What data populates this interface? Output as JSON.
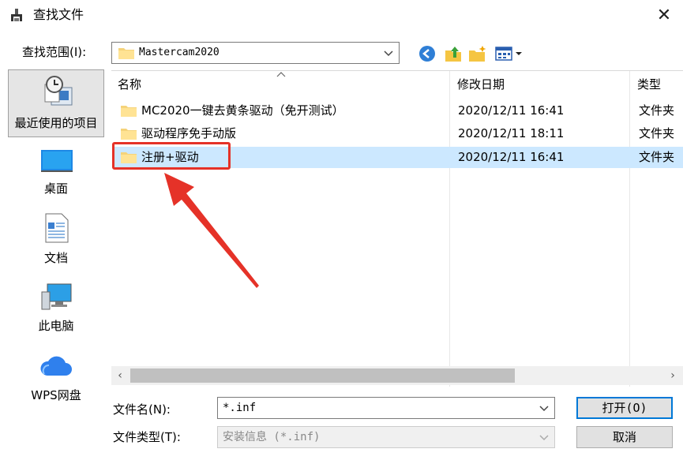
{
  "window": {
    "title": "查找文件",
    "close_glyph": "✕"
  },
  "look_in": {
    "label": "查找范围(I):",
    "value": "Mastercam2020"
  },
  "toolbar": {
    "icons": [
      "back-icon",
      "up-folder-icon",
      "new-folder-icon",
      "view-menu-icon"
    ]
  },
  "places": [
    {
      "label": "最近使用的项目",
      "icon": "recent-items-icon",
      "selected": true
    },
    {
      "label": "桌面",
      "icon": "desktop-icon",
      "selected": false
    },
    {
      "label": "文档",
      "icon": "documents-icon",
      "selected": false
    },
    {
      "label": "此电脑",
      "icon": "this-pc-icon",
      "selected": false
    },
    {
      "label": "WPS网盘",
      "icon": "wps-cloud-icon",
      "selected": false
    }
  ],
  "columns": {
    "name": "名称",
    "date": "修改日期",
    "type": "类型"
  },
  "files": [
    {
      "name": "MC2020一键去黄条驱动（免开测试）",
      "date": "2020/12/11 16:41",
      "type": "文件夹",
      "selected": false
    },
    {
      "name": "驱动程序免手动版",
      "date": "2020/12/11 18:11",
      "type": "文件夹",
      "selected": false
    },
    {
      "name": "注册+驱动",
      "date": "2020/12/11 16:41",
      "type": "文件夹",
      "selected": true
    }
  ],
  "file_name": {
    "label": "文件名(N):",
    "value": "*.inf"
  },
  "file_type": {
    "label": "文件类型(T):",
    "value": "安装信息 (*.inf)"
  },
  "buttons": {
    "open": "打开(O)",
    "cancel": "取消"
  },
  "colors": {
    "selection": "#cce8ff",
    "annotation": "#e53228",
    "default_button_border": "#0078d7"
  }
}
